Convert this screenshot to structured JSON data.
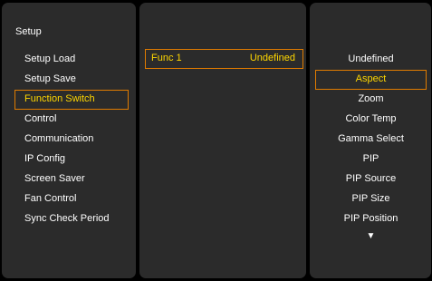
{
  "colors": {
    "background": "#000000",
    "panel": "#2b2b2b",
    "text": "#ffffff",
    "highlight_text": "#ffd700",
    "highlight_border": "#e07b00"
  },
  "menu": {
    "title": "Setup",
    "items": [
      {
        "label": "Setup Load",
        "selected": false
      },
      {
        "label": "Setup Save",
        "selected": false
      },
      {
        "label": "Function Switch",
        "selected": true
      },
      {
        "label": "Control",
        "selected": false
      },
      {
        "label": "Communication",
        "selected": false
      },
      {
        "label": "IP Config",
        "selected": false
      },
      {
        "label": "Screen Saver",
        "selected": false
      },
      {
        "label": "Fan Control",
        "selected": false
      },
      {
        "label": "Sync Check Period",
        "selected": false
      }
    ]
  },
  "function": {
    "name": "Func 1",
    "value": "Undefined"
  },
  "options": {
    "items": [
      {
        "label": "Undefined",
        "selected": false
      },
      {
        "label": "Aspect",
        "selected": true
      },
      {
        "label": "Zoom",
        "selected": false
      },
      {
        "label": "Color Temp",
        "selected": false
      },
      {
        "label": "Gamma Select",
        "selected": false
      },
      {
        "label": "PIP",
        "selected": false
      },
      {
        "label": "PIP Source",
        "selected": false
      },
      {
        "label": "PIP Size",
        "selected": false
      },
      {
        "label": "PIP Position",
        "selected": false
      }
    ],
    "more_icon": "down-triangle-icon",
    "more_glyph": "▼"
  }
}
